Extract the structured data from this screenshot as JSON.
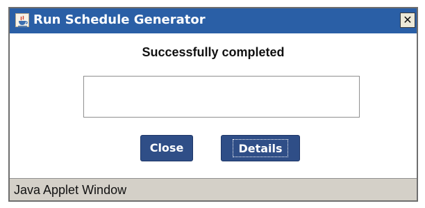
{
  "window": {
    "title": "Run Schedule Generator",
    "close_glyph": "✕",
    "icon": "java-icon",
    "accent_color": "#2a5fa6"
  },
  "content": {
    "message": "Successfully completed",
    "details_text": ""
  },
  "buttons": {
    "close_label": "Close",
    "details_label": "Details"
  },
  "statusbar": {
    "text": "Java Applet Window"
  }
}
